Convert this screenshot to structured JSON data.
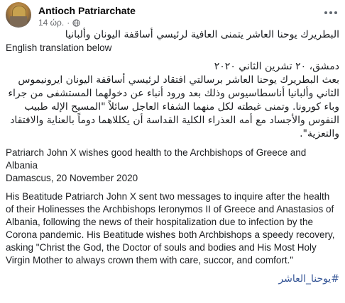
{
  "header": {
    "page_name": "Antioch Patriarchate",
    "time": "14 ώρ.",
    "separator": "·"
  },
  "post": {
    "arabic_title": "البطريرك يوحنا العاشر يتمنى العافية لرئيسي أساقفة اليونان وألبانيا",
    "translation_note": "English translation below",
    "arabic_date": "دمشق، ٢٠ تشرين الثاني ٢٠٢٠",
    "arabic_body": "بعث البطريرك يوحنا العاشر برسالتي افتقاد لرئيسي أساقفة اليونان ايرونيموس الثاني وألبانيا أناسطاسيوس وذلك بعد ورود أنباء عن دخولهما المستشفى من جراء وباء كورونا. وتمنى غبطته لكل منهما الشفاء العاجل سائلاً \"المسيح الإله طبيب النفوس والأجساد مع أمه العذراء الكلية القداسة أن يكللاهما دوماً بالعناية والافتقاد والتعزية\".",
    "english_title": "Patriarch John X wishes good health to the Archbishops of Greece and Albania",
    "english_date": "Damascus, 20 November 2020",
    "english_body": "His Beatitude Patriarch John X sent two messages to inquire after the health of their Holinesses the Archbishops Ieronymos II of Greece and Anastasios of Albania, following the news of their hospitalization due to infection by the Corona pandemic. His Beatitude wishes both Archbishops a speedy recovery, asking \"Christ the God, the Doctor of souls and bodies and His Most Holy Virgin Mother to always crown them with care, succor, and comfort.\"",
    "hashtag": "#يوحنا_العاشر"
  },
  "colors": {
    "text": "#1c1e21",
    "meta": "#65676b",
    "link": "#385898"
  }
}
